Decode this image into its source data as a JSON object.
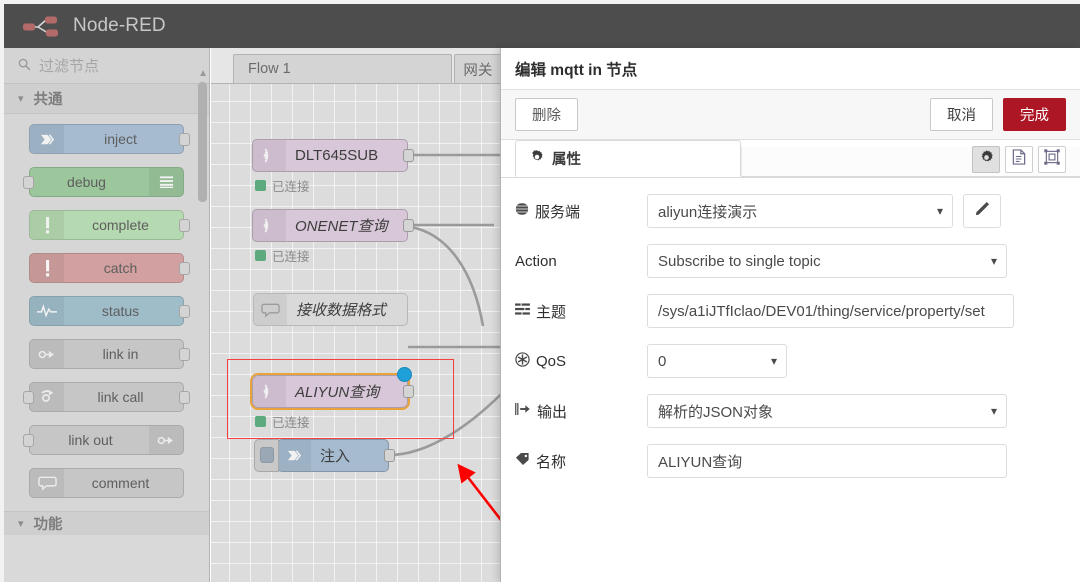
{
  "header": {
    "app_title": "Node-RED",
    "logo_icon": "node-red-logo-icon"
  },
  "palette": {
    "search": {
      "placeholder": "过滤节点",
      "icon": "search-icon"
    },
    "category_common": {
      "label": "共通",
      "caret": "chevron-down-icon"
    },
    "category_function": {
      "label": "功能",
      "caret": "chevron-down-icon"
    },
    "nodes": [
      {
        "label": "inject",
        "color": "#a6bbcf",
        "icon": "inject-arrow-icon",
        "icon_side": "left",
        "port_out": true,
        "port_in": false
      },
      {
        "label": "debug",
        "color": "#9cc69c",
        "icon": "debug-list-icon",
        "icon_side": "right",
        "port_out": false,
        "port_in": true
      },
      {
        "label": "complete",
        "color": "#b5d9b0",
        "icon": "exclamation-icon",
        "icon_side": "left",
        "port_out": true,
        "port_in": false
      },
      {
        "label": "catch",
        "color": "#d2a0a0",
        "icon": "exclamation-icon",
        "icon_side": "left",
        "port_out": true,
        "port_in": false
      },
      {
        "label": "status",
        "color": "#9fbdc9",
        "icon": "pulse-icon",
        "icon_side": "left",
        "port_out": true,
        "port_in": false
      },
      {
        "label": "link in",
        "color": "#c6c6c6",
        "icon": "link-in-icon",
        "icon_side": "left",
        "port_out": true,
        "port_in": false
      },
      {
        "label": "link call",
        "color": "#c6c6c6",
        "icon": "link-call-icon",
        "icon_side": "left",
        "port_out": true,
        "port_in": true
      },
      {
        "label": "link out",
        "color": "#c6c6c6",
        "icon": "link-out-icon",
        "icon_side": "right",
        "port_out": false,
        "port_in": true
      },
      {
        "label": "comment",
        "color": "#c6c6c6",
        "icon": "comment-icon",
        "icon_side": "left",
        "port_out": false,
        "port_in": false
      }
    ]
  },
  "workspace": {
    "tabs": [
      {
        "label": "Flow 1",
        "active": false
      },
      {
        "label": "网关",
        "active": false
      }
    ],
    "canvas_nodes": [
      {
        "label": "DLT645SUB",
        "type": "mqtt",
        "icon": "mqtt-wifi-icon",
        "status": "已连接",
        "status_color": "#5eaa7f",
        "selected": false,
        "italic": false
      },
      {
        "label": "ONENET查询",
        "type": "mqtt",
        "icon": "mqtt-wifi-icon",
        "status": "已连接",
        "status_color": "#5eaa7f",
        "selected": false,
        "italic": true
      },
      {
        "label": "接收数据格式",
        "type": "comment",
        "icon": "comment-icon",
        "status": "",
        "status_color": "",
        "selected": false,
        "italic": true
      },
      {
        "label": "ALIYUN查询",
        "type": "mqtt",
        "icon": "mqtt-wifi-icon",
        "status": "已连接",
        "status_color": "#5eaa7f",
        "selected": true,
        "italic": true
      },
      {
        "label": "注入",
        "type": "inject",
        "icon": "inject-arrow-icon",
        "status": "",
        "status_color": "",
        "selected": false,
        "italic": false
      }
    ],
    "annotation": {
      "highlight_color": "#f5403f",
      "arrow_color": "#fd0000"
    }
  },
  "dialog": {
    "title": "编辑 mqtt in 节点",
    "buttons": {
      "delete": "删除",
      "cancel": "取消",
      "done": "完成",
      "done_color": "#ad1625"
    },
    "tab": {
      "label": "属性",
      "icon": "gear-icon"
    },
    "icon_buttons": [
      {
        "name": "properties-gear-icon",
        "glyph": "gear-icon",
        "active": true
      },
      {
        "name": "description-doc-icon",
        "glyph": "document-icon",
        "active": false
      },
      {
        "name": "appearance-outline-icon",
        "glyph": "appearance-icon",
        "active": false
      }
    ],
    "fields": [
      {
        "label": "服务端",
        "icon": "globe-icon",
        "control": "select",
        "value": "aliyun连接演示",
        "extra": "pencil-edit-button"
      },
      {
        "label": "Action",
        "icon": "",
        "control": "select",
        "value": "Subscribe to single topic",
        "extra": ""
      },
      {
        "label": "主题",
        "icon": "tasks-icon",
        "control": "input",
        "value": "/sys/a1iJTfIclao/DEV01/thing/service/property/set",
        "extra": ""
      },
      {
        "label": "QoS",
        "icon": "asterisk-icon",
        "control": "select",
        "value": "0",
        "extra": ""
      },
      {
        "label": "输出",
        "icon": "sign-out-icon",
        "control": "select",
        "value": "解析的JSON对象",
        "extra": ""
      },
      {
        "label": "名称",
        "icon": "tag-icon",
        "control": "input",
        "value": "ALIYUN查询",
        "extra": ""
      }
    ]
  }
}
